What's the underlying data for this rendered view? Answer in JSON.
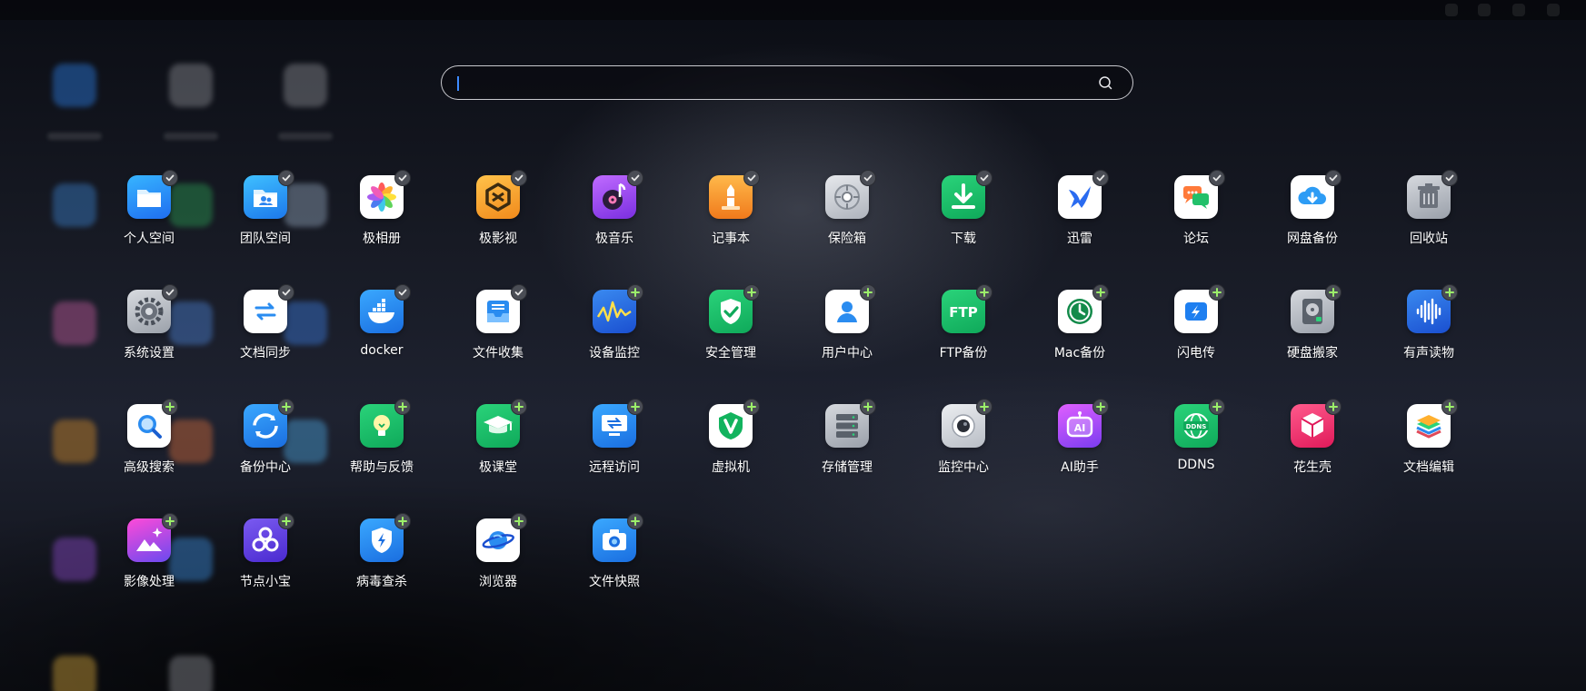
{
  "search": {
    "value": "",
    "placeholder": ""
  },
  "apps": [
    {
      "label": "个人空间",
      "icon": "folder-icon",
      "badge": "pinned"
    },
    {
      "label": "团队空间",
      "icon": "team-folder-icon",
      "badge": "pinned"
    },
    {
      "label": "极相册",
      "icon": "photos-flower-icon",
      "badge": "pinned"
    },
    {
      "label": "极影视",
      "icon": "video-cube-icon",
      "badge": "pinned"
    },
    {
      "label": "极音乐",
      "icon": "music-disc-icon",
      "badge": "pinned"
    },
    {
      "label": "记事本",
      "icon": "notebook-icon",
      "badge": "pinned"
    },
    {
      "label": "保险箱",
      "icon": "safe-icon",
      "badge": "pinned"
    },
    {
      "label": "下载",
      "icon": "download-icon",
      "badge": "pinned"
    },
    {
      "label": "迅雷",
      "icon": "thunder-bird-icon",
      "badge": "pinned"
    },
    {
      "label": "论坛",
      "icon": "chat-bubbles-icon",
      "badge": "pinned"
    },
    {
      "label": "网盘备份",
      "icon": "cloud-download-icon",
      "badge": "pinned"
    },
    {
      "label": "回收站",
      "icon": "trash-icon",
      "badge": "pinned"
    },
    {
      "label": "系统设置",
      "icon": "gear-icon",
      "badge": "pinned"
    },
    {
      "label": "文档同步",
      "icon": "sync-arrows-icon",
      "badge": "pinned"
    },
    {
      "label": "docker",
      "icon": "docker-whale-icon",
      "badge": "pinned"
    },
    {
      "label": "文件收集",
      "icon": "inbox-tray-icon",
      "badge": "pinned"
    },
    {
      "label": "设备监控",
      "icon": "waveform-chart-icon",
      "badge": "add"
    },
    {
      "label": "安全管理",
      "icon": "shield-check-icon",
      "badge": "add"
    },
    {
      "label": "用户中心",
      "icon": "user-icon",
      "badge": "add"
    },
    {
      "label": "FTP备份",
      "icon": "ftp-icon",
      "badge": "add"
    },
    {
      "label": "Mac备份",
      "icon": "time-machine-icon",
      "badge": "add"
    },
    {
      "label": "闪电传",
      "icon": "lightning-transfer-icon",
      "badge": "add"
    },
    {
      "label": "硬盘搬家",
      "icon": "hard-disk-icon",
      "badge": "add"
    },
    {
      "label": "有声读物",
      "icon": "audio-wave-icon",
      "badge": "add"
    },
    {
      "label": "高级搜索",
      "icon": "magnifier-icon",
      "badge": "add"
    },
    {
      "label": "备份中心",
      "icon": "backup-cycle-icon",
      "badge": "add"
    },
    {
      "label": "帮助与反馈",
      "icon": "lightbulb-icon",
      "badge": "add"
    },
    {
      "label": "极课堂",
      "icon": "graduation-cap-icon",
      "badge": "add"
    },
    {
      "label": "远程访问",
      "icon": "remote-desktop-icon",
      "badge": "add"
    },
    {
      "label": "虚拟机",
      "icon": "vm-v-icon",
      "badge": "add"
    },
    {
      "label": "存储管理",
      "icon": "storage-server-icon",
      "badge": "add"
    },
    {
      "label": "监控中心",
      "icon": "camera-lens-icon",
      "badge": "add"
    },
    {
      "label": "AI助手",
      "icon": "ai-robot-icon",
      "badge": "add"
    },
    {
      "label": "DDNS",
      "icon": "ddns-globe-icon",
      "badge": "add"
    },
    {
      "label": "花生壳",
      "icon": "peanut-box-icon",
      "badge": "add"
    },
    {
      "label": "文档编辑",
      "icon": "layers-icon",
      "badge": "add"
    },
    {
      "label": "影像处理",
      "icon": "image-sparkle-icon",
      "badge": "add"
    },
    {
      "label": "节点小宝",
      "icon": "node-knot-icon",
      "badge": "add"
    },
    {
      "label": "病毒查杀",
      "icon": "antivirus-shield-icon",
      "badge": "add"
    },
    {
      "label": "浏览器",
      "icon": "planet-browser-icon",
      "badge": "add"
    },
    {
      "label": "文件快照",
      "icon": "camera-snapshot-icon",
      "badge": "add"
    }
  ]
}
